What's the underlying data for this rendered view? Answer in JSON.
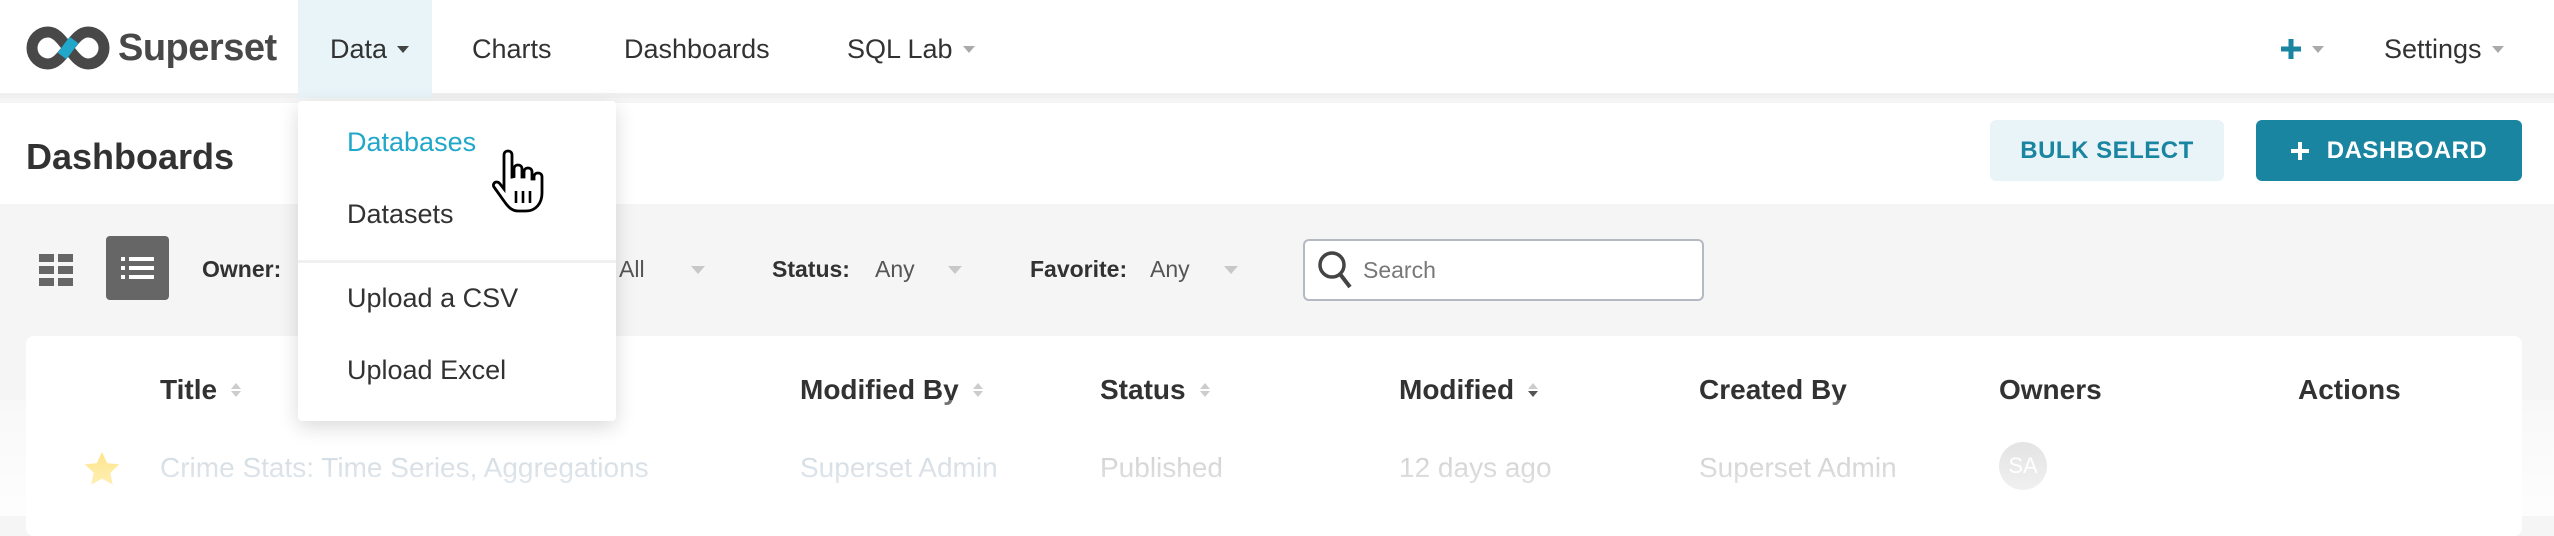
{
  "nav": {
    "brand": "Superset",
    "items": [
      {
        "label": "Data",
        "has_caret": true,
        "active": true
      },
      {
        "label": "Charts"
      },
      {
        "label": "Dashboards"
      },
      {
        "label": "SQL Lab",
        "has_caret": true
      }
    ],
    "plus_icon": "plus-icon",
    "settings_label": "Settings"
  },
  "data_menu": {
    "items": [
      "Databases",
      "Datasets",
      "Upload a CSV",
      "Upload Excel"
    ],
    "highlighted": "Databases"
  },
  "header": {
    "title": "Dashboards",
    "bulk_select_label": "BULK SELECT",
    "add_dashboard_label": "DASHBOARD"
  },
  "filters": {
    "owner_label": "Owner:",
    "owner_value": "All",
    "status_label": "Status:",
    "status_value": "Any",
    "favorite_label": "Favorite:",
    "favorite_value": "Any",
    "search_placeholder": "Search"
  },
  "table": {
    "columns": [
      "Title",
      "Modified By",
      "Status",
      "Modified",
      "Created By",
      "Owners",
      "Actions"
    ],
    "rows": [
      {
        "title": "Crime Stats: Time Series, Aggregations",
        "modified_by": "Superset Admin",
        "status": "Published",
        "modified": "12 days ago",
        "created_by": "Superset Admin",
        "owner_initials": "SA",
        "favorite": true
      }
    ]
  },
  "colors": {
    "accent": "#1a85a0",
    "highlight": "#20a7c9",
    "active_bg": "#e9f4f9",
    "star": "#fcc700"
  }
}
